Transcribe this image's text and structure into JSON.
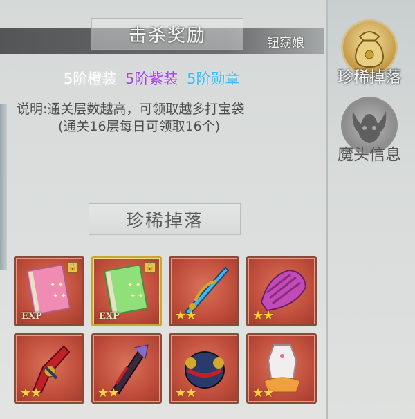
{
  "kill_reward": {
    "title": "击杀奖励"
  },
  "npc_name": "钮窈娘",
  "reward_tiers": [
    {
      "text": "5阶橙装",
      "color": "#ffffff"
    },
    {
      "text": "5阶紫装",
      "color": "#a241f0"
    },
    {
      "text": "5阶勋章",
      "color": "#39b8f2"
    }
  ],
  "description": {
    "line1": "说明:通关层数越高，可领取越多打宝袋",
    "line2": "(通关16层每日可领取16个)"
  },
  "rare_drops": {
    "title": "珍稀掉落",
    "items": [
      {
        "icon": "pink-exp-book-icon",
        "exp": "EXP",
        "locked": true,
        "stars": "",
        "frame": "red"
      },
      {
        "icon": "green-exp-book-icon",
        "exp": "EXP",
        "locked": true,
        "stars": "",
        "frame": "gold"
      },
      {
        "icon": "blue-serpent-blade-icon",
        "exp": "",
        "locked": false,
        "stars": "★★",
        "frame": "red"
      },
      {
        "icon": "purple-gauntlet-icon",
        "exp": "",
        "locked": false,
        "stars": "★★",
        "frame": "red"
      },
      {
        "icon": "red-cannon-weapon-icon",
        "exp": "",
        "locked": false,
        "stars": "★★",
        "frame": "red"
      },
      {
        "icon": "dark-scepter-icon",
        "exp": "",
        "locked": false,
        "stars": "★★",
        "frame": "red"
      },
      {
        "icon": "armor-robe-icon",
        "exp": "",
        "locked": false,
        "stars": "★★",
        "frame": "red"
      },
      {
        "icon": "white-orange-bodysuit-icon",
        "exp": "",
        "locked": false,
        "stars": "★★",
        "frame": "red"
      }
    ]
  },
  "side_tabs": [
    {
      "label": "珍稀掉落",
      "icon": "treasure-bag-icon",
      "active": true
    },
    {
      "label": "魔头信息",
      "icon": "demon-head-icon",
      "active": false
    }
  ]
}
